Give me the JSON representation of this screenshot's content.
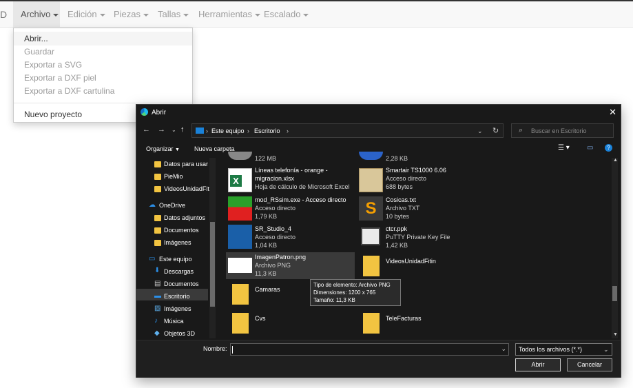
{
  "navbar": {
    "brand": "D",
    "menus": [
      {
        "label": "Archivo"
      },
      {
        "label": "Edición"
      },
      {
        "label": "Piezas"
      },
      {
        "label": "Tallas"
      },
      {
        "label": "Herramientas"
      },
      {
        "label": "Escalado"
      }
    ]
  },
  "file_menu": {
    "items": [
      {
        "label": "Abrir..."
      },
      {
        "label": "Guardar"
      },
      {
        "label": "Exportar a SVG"
      },
      {
        "label": "Exportar a DXF piel"
      },
      {
        "label": "Exportar a DXF cartulina"
      },
      {
        "label": "Nuevo proyecto"
      }
    ]
  },
  "dialog": {
    "title": "Abrir",
    "breadcrumb": [
      "Este equipo",
      "Escritorio"
    ],
    "search_placeholder": "Buscar en Escritorio",
    "organize_label": "Organizar",
    "new_folder_label": "Nueva carpeta",
    "nav_pane": [
      {
        "label": "Datos para usar c",
        "icon": "folder-icon"
      },
      {
        "label": "PieMio",
        "icon": "folder-icon"
      },
      {
        "label": "VideosUnidadFit",
        "icon": "folder-icon"
      },
      {
        "label": "OneDrive",
        "icon": "cloud-icon"
      },
      {
        "label": "Datos adjuntos",
        "icon": "folder-icon"
      },
      {
        "label": "Documentos",
        "icon": "folder-icon"
      },
      {
        "label": "Imágenes",
        "icon": "folder-icon"
      },
      {
        "label": "Este equipo",
        "icon": "computer-icon"
      },
      {
        "label": "Descargas",
        "icon": "download-icon"
      },
      {
        "label": "Documentos",
        "icon": "document-icon"
      },
      {
        "label": "Escritorio",
        "icon": "desktop-icon"
      },
      {
        "label": "Imágenes",
        "icon": "pictures-icon"
      },
      {
        "label": "Música",
        "icon": "music-icon"
      },
      {
        "label": "Objetos 3D",
        "icon": "cube-icon"
      }
    ],
    "files_left": [
      {
        "partial_size": "122 MB"
      },
      {
        "name_line1": "Líneas telefonía - orange -",
        "name_line2": "migracion.xlsx",
        "type": "Hoja de cálculo de Microsoft Excel",
        "icon": "excel-icon"
      },
      {
        "name": "mod_RSsim.exe - Acceso directo",
        "type": "Acceso directo",
        "size": "1,79 KB",
        "icon": "modbus-icon"
      },
      {
        "name": "SR_Studio_4",
        "type": "Acceso directo",
        "size": "1,04 KB",
        "icon": "shortcut-icon"
      },
      {
        "name": "ImagenPatron.png",
        "type": "Archivo PNG",
        "size": "11,3 KB",
        "icon": "png-thumbnail"
      },
      {
        "name": "Camaras",
        "icon": "folder-icon"
      },
      {
        "name": "Cvs",
        "icon": "folder-icon"
      }
    ],
    "files_right": [
      {
        "partial_size": "2,28 KB"
      },
      {
        "name": "Smartair TS1000 6.06",
        "type": "Acceso directo",
        "size": "688 bytes",
        "icon": "app-shortcut-icon"
      },
      {
        "name": "Cosicas.txt",
        "type": "Archivo TXT",
        "size": "10 bytes",
        "icon": "sublime-icon"
      },
      {
        "name": "ctcr.ppk",
        "type": "PuTTY Private Key File",
        "size": "1,42 KB",
        "icon": "putty-icon"
      },
      {
        "name": "VideosUnidadFitin",
        "icon": "folder-icon"
      },
      {
        "name": "TeleFacturas",
        "icon": "folder-icon"
      }
    ],
    "tooltip": [
      "Tipo de elemento: Archivo PNG",
      "Dimensiones: 1200 x 765",
      "Tamaño: 11,3 KB"
    ],
    "filename_label": "Nombre:",
    "filename_value": "",
    "file_type": "Todos los archivos (*.*)",
    "open_button": "Abrir",
    "cancel_button": "Cancelar"
  }
}
